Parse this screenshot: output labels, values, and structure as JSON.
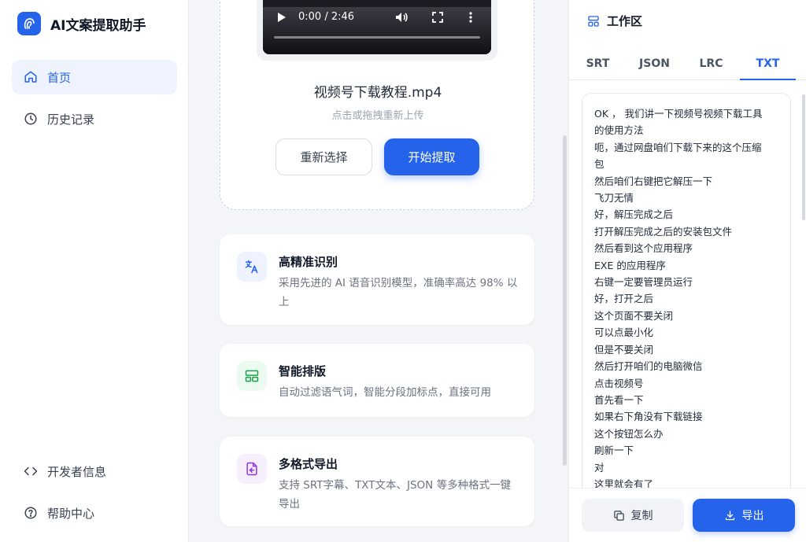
{
  "sidebar": {
    "brand": "AI文案提取助手",
    "nav": [
      {
        "label": "首页",
        "icon": "home-icon",
        "active": true
      },
      {
        "label": "历史记录",
        "icon": "clock-icon",
        "active": false
      }
    ],
    "bottom": [
      {
        "label": "开发者信息",
        "icon": "code-icon"
      },
      {
        "label": "帮助中心",
        "icon": "help-icon"
      }
    ]
  },
  "upload": {
    "video_time": "0:00 / 2:46",
    "file_name": "视频号下载教程.mp4",
    "hint": "点击或拖拽重新上传",
    "reselect_label": "重新选择",
    "start_label": "开始提取"
  },
  "features": [
    {
      "title": "高精准识别",
      "desc": "采用先进的 AI 语音识别模型，准确率高达 98% 以上",
      "icon": "translate-icon",
      "color": "#2563eb",
      "bg": "#eef3fe"
    },
    {
      "title": "智能排版",
      "desc": "自动过滤语气词，智能分段加标点，直接可用",
      "icon": "layout-icon",
      "color": "#16a34a",
      "bg": "#ecfbf1"
    },
    {
      "title": "多格式导出",
      "desc": "支持 SRT字幕、TXT文本、JSON 等多种格式一键导出",
      "icon": "file-export-icon",
      "color": "#9333ea",
      "bg": "#f6effd"
    }
  ],
  "workspace": {
    "title": "工作区",
    "tabs": [
      {
        "label": "SRT",
        "active": false
      },
      {
        "label": "JSON",
        "active": false
      },
      {
        "label": "LRC",
        "active": false
      },
      {
        "label": "TXT",
        "active": true
      }
    ],
    "lines": [
      "OK ， 我们讲一下视频号视频下载工具",
      "的使用方法",
      "呃，通过网盘咱们下载下来的这个压缩",
      "包",
      "然后咱们右键把它解压一下",
      "飞刀无情",
      "好，解压完成之后",
      "打开解压完成之后的安装包文件",
      "然后看到这个应用程序",
      "EXE 的应用程序",
      "右键一定要管理员运行",
      "好，打开之后",
      "这个页面不要关闭",
      "可以点最小化",
      "但是不要关闭",
      "然后打开咱们的电脑微信",
      "点击视频号",
      "首先看一下",
      "如果右下角没有下载链接",
      "这个按钮怎么办",
      "刷新一下",
      "对",
      "这里就会有了"
    ],
    "copy_label": "复制",
    "export_label": "导出"
  },
  "colors": {
    "accent": "#2563eb",
    "active_bg": "#eef3fe"
  }
}
